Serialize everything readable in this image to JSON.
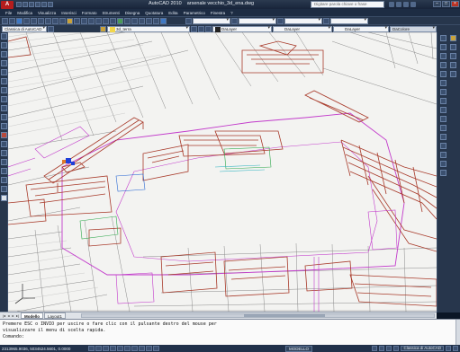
{
  "window": {
    "app_title": "AutoCAD 2010",
    "file_name": "arsenale vecchio_3d_ena.dwg",
    "search_placeholder": "Digitare parola chiave o frase",
    "app_button": "A"
  },
  "menu": {
    "items": [
      "File",
      "Modifica",
      "Visualizza",
      "Inserisci",
      "Formato",
      "Strumenti",
      "Disegna",
      "Quotatura",
      "Edita",
      "Parametrico",
      "Finestra",
      "?"
    ]
  },
  "toolbar": {
    "workspace": "Classica di AutoCAD",
    "layer_current": "3d_terra",
    "color_value": "DaLayer",
    "linetype_value": "DaLayer",
    "lineweight_value": "DaLayer",
    "plotstyle_value": "DaColore"
  },
  "layout_tabs": {
    "items": [
      "Modello",
      "Layout1"
    ],
    "active": "Modello"
  },
  "command_line": {
    "line1": "Premere ESC o INVIO per uscire o fare clic con il pulsante destro del mouse per",
    "line2": "visualizzare il menu di scelta rapida.",
    "prompt": "Comando:"
  },
  "status_bar": {
    "coordinates": "2313965.9036, 5034524.5601, 0.0000",
    "mode": "MODELLO",
    "workspace_label": "Classica di AutoCAD"
  },
  "colors": {
    "walls": "#a83a2a",
    "annotations": "#c23acb",
    "base_map": "#7c7c7c",
    "highlight": "#1f3fd8",
    "canvas": "#f3f3f1"
  }
}
